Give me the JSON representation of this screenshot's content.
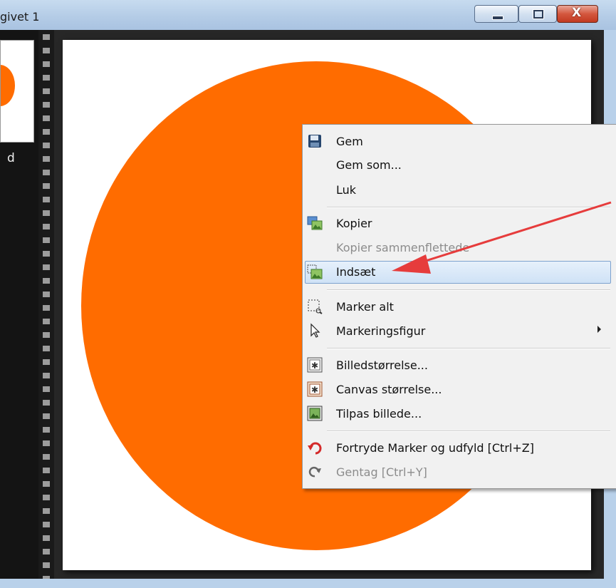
{
  "window": {
    "title": "givet 1",
    "buttons": {
      "minimize": "minimize",
      "maximize": "maximize",
      "close": "X"
    }
  },
  "sidebar": {
    "thumbnail_label": "d"
  },
  "colors": {
    "circle_fill": "#ff6c00",
    "menu_highlight": "#cfe2f6",
    "arrow": "#e63c3c"
  },
  "context_menu": {
    "items": [
      {
        "label": "Gem",
        "icon": "save-icon",
        "enabled": true
      },
      {
        "label": "Gem som...",
        "icon": null,
        "enabled": true
      },
      {
        "label": "Luk",
        "icon": null,
        "enabled": true
      },
      {
        "label": "Kopier",
        "icon": "copy-image-icon",
        "enabled": true
      },
      {
        "label": "Kopier sammenflettede",
        "icon": null,
        "enabled": false
      },
      {
        "label": "Indsæt",
        "icon": "paste-image-icon",
        "enabled": true,
        "highlighted": true
      },
      {
        "label": "Marker alt",
        "icon": "select-all-icon",
        "enabled": true
      },
      {
        "label": "Markeringsfigur",
        "icon": "pointer-icon",
        "enabled": true,
        "submenu": true
      },
      {
        "label": "Billedstørrelse...",
        "icon": "image-size-icon",
        "enabled": true
      },
      {
        "label": "Canvas størrelse...",
        "icon": "canvas-size-icon",
        "enabled": true
      },
      {
        "label": "Tilpas billede...",
        "icon": "fit-image-icon",
        "enabled": true
      },
      {
        "label": "Fortryde Marker og udfyld [Ctrl+Z]",
        "icon": "undo-icon",
        "enabled": true
      },
      {
        "label": "Gentag [Ctrl+Y]",
        "icon": "redo-icon",
        "enabled": false
      }
    ]
  }
}
